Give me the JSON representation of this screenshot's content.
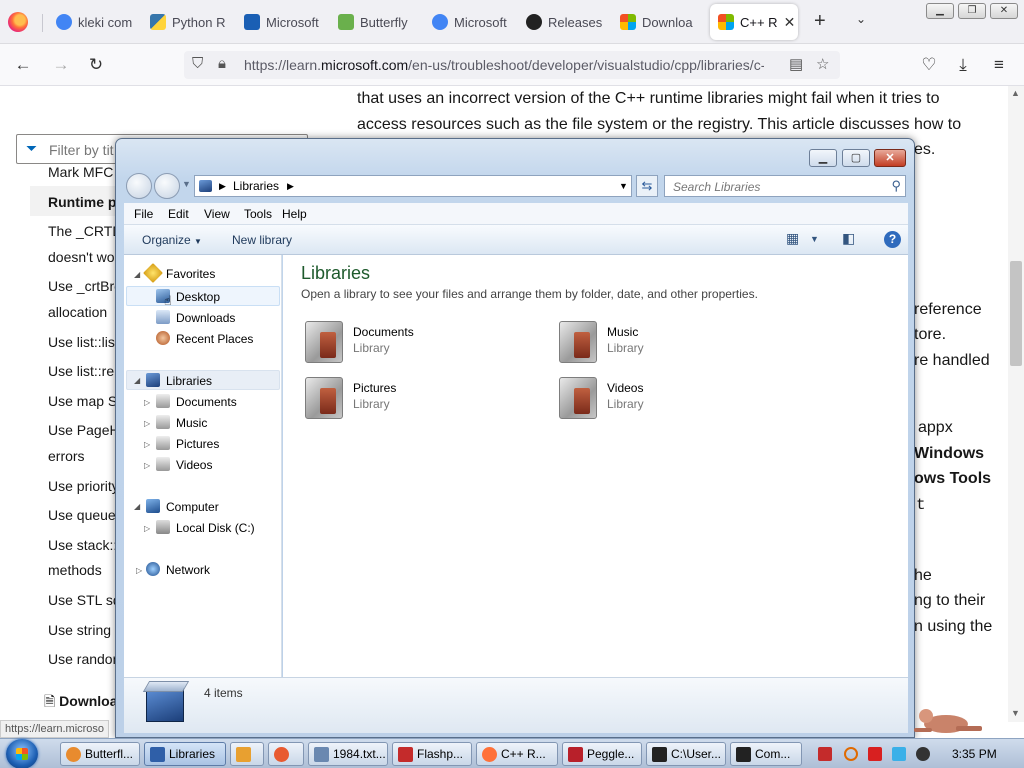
{
  "browser": {
    "tabs": [
      {
        "label": "kleki com",
        "favicon_color": "#4285f4"
      },
      {
        "label": "Python R",
        "favicon_color": "#3776ab"
      },
      {
        "label": "Microsoft",
        "favicon_color": "#1a5fb4"
      },
      {
        "label": "Butterfly",
        "favicon_color": "#6ab04c"
      },
      {
        "label": "Microsoft",
        "favicon_color": "#4285f4"
      },
      {
        "label": "Releases",
        "favicon_color": "#222222"
      },
      {
        "label": "Downloa",
        "favicon_color": "#f25022"
      },
      {
        "label": "C++ R",
        "favicon_color": "#f25022"
      }
    ],
    "url_prefix": "https://learn.",
    "url_domain": "microsoft.com",
    "url_rest": "/en-us/troubleshoot/developer/visualstudio/cpp/libraries/c-r",
    "status_url": "https://learn.microso"
  },
  "page": {
    "filter_placeholder": "Filter by tit",
    "toc": [
      {
        "label": "Mark MFC",
        "bold": false
      },
      {
        "label": "Runtime pa",
        "bold": true
      },
      {
        "label": "The _CRTD",
        "bold": false
      },
      {
        "label": "doesn't wo",
        "bold": false
      },
      {
        "label": "Use _crtBre",
        "bold": false
      },
      {
        "label": "allocation",
        "bold": false
      },
      {
        "label": "Use list::list",
        "bold": false
      },
      {
        "label": "Use list::rer",
        "bold": false
      },
      {
        "label": "Use map ST",
        "bold": false
      },
      {
        "label": "Use PageH",
        "bold": false
      },
      {
        "label": "errors",
        "bold": false
      },
      {
        "label": "Use priority",
        "bold": false
      },
      {
        "label": "Use queue",
        "bold": false
      },
      {
        "label": "Use stack::t",
        "bold": false
      },
      {
        "label": "methods",
        "bold": false
      },
      {
        "label": "Use STL sq",
        "bold": false
      },
      {
        "label": "Use string",
        "bold": false
      },
      {
        "label": "Use randon",
        "bold": false
      }
    ],
    "download_label": "Download P",
    "article_lines": [
      "that uses an incorrect version of the C++ runtime libraries might fail when it tries to",
      "access resources such as the file system or the registry. This article discusses how to"
    ],
    "right_fragments": [
      {
        "text": "es.",
        "bold": false
      },
      {
        "text": "reference",
        "bold": false
      },
      {
        "text": "tore.",
        "bold": false
      },
      {
        "text": "re handled",
        "bold": false
      },
      {
        "text": "appx",
        "bold": false
      },
      {
        "text": "Windows",
        "bold": true
      },
      {
        "text": "ows Tools",
        "bold": true
      },
      {
        "text": "t",
        "bold": false
      },
      {
        "text": "he",
        "bold": false
      },
      {
        "text": "ng to their",
        "bold": false
      },
      {
        "text": "n using the",
        "bold": false
      }
    ]
  },
  "explorer": {
    "address_label": "Libraries",
    "search_placeholder": "Search Libraries",
    "menu": [
      "File",
      "Edit",
      "View",
      "Tools",
      "Help"
    ],
    "organize_label": "Organize",
    "new_library_label": "New library",
    "favorites_label": "Favorites",
    "favorites": [
      "Desktop",
      "Downloads",
      "Recent Places"
    ],
    "libraries_label": "Libraries",
    "libraries": [
      "Documents",
      "Music",
      "Pictures",
      "Videos"
    ],
    "computer_label": "Computer",
    "drives": [
      "Local Disk (C:)"
    ],
    "network_label": "Network",
    "content_title": "Libraries",
    "content_subtitle": "Open a library to see your files and arrange them by folder, date, and other properties.",
    "items": [
      {
        "name": "Documents",
        "kind": "Library"
      },
      {
        "name": "Music",
        "kind": "Library"
      },
      {
        "name": "Pictures",
        "kind": "Library"
      },
      {
        "name": "Videos",
        "kind": "Library"
      }
    ],
    "item_count": "4 items"
  },
  "taskbar": {
    "buttons": [
      {
        "label": "Butterfl...",
        "icon_color": "#e88b2e"
      },
      {
        "label": "Libraries",
        "icon_color": "#2f5fa8"
      },
      {
        "label": "",
        "icon_color": "#e8a030"
      },
      {
        "label": "",
        "icon_color": "#e85a30"
      },
      {
        "label": "1984.txt...",
        "icon_color": "#6a88b0"
      },
      {
        "label": "Flashp...",
        "icon_color": "#c42b2b"
      },
      {
        "label": "C++ R...",
        "icon_color": "#ff7139"
      },
      {
        "label": "Peggle...",
        "icon_color": "#b8202a"
      },
      {
        "label": "C:\\User...",
        "icon_color": "#222222"
      },
      {
        "label": "Com...",
        "icon_color": "#222222"
      }
    ],
    "tray_icons": [
      "vivaldi-icon",
      "search-icon",
      "flag-icon",
      "monitor-icon",
      "volume-icon"
    ],
    "clock": "3:35 PM"
  }
}
